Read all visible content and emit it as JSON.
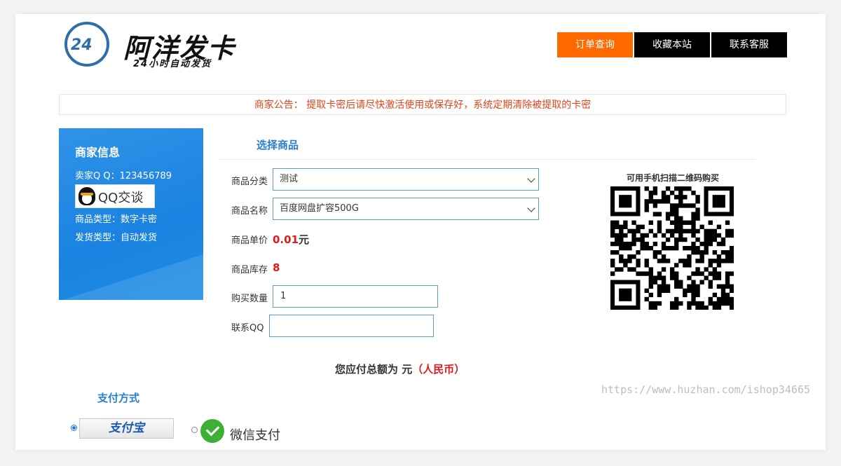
{
  "header": {
    "logo_number": "24",
    "brand_name": "阿洋发卡",
    "brand_tagline": "24小时自动发货",
    "nav": [
      {
        "label": "订单查询",
        "color": "#ff6a00"
      },
      {
        "label": "收藏本站",
        "color": "#000000"
      },
      {
        "label": "联系客服",
        "color": "#000000"
      }
    ]
  },
  "notice": {
    "text": "商家公告： 提取卡密后请尽快激活使用或保存好，系统定期清除被提取的卡密"
  },
  "merchant": {
    "title": "商家信息",
    "qq_line": "卖家Q Q：123456789",
    "qq_button": "QQ交谈",
    "type_line": "商品类型：数字卡密",
    "delivery_line": "发货类型：自动发货"
  },
  "form": {
    "section_title": "选择商品",
    "category_label": "商品分类",
    "category_value": "测试",
    "name_label": "商品名称",
    "name_value": "百度网盘扩容500G",
    "price_label": "商品单价",
    "price_value": "0.01",
    "price_unit": "元",
    "stock_label": "商品库存",
    "stock_value": "8",
    "qty_label": "购买数量",
    "qty_value": "1",
    "contact_label": "联系QQ",
    "contact_value": ""
  },
  "total": {
    "prefix": "您应付总额为 元",
    "currency": "（人民币）"
  },
  "qr": {
    "title": "可用手机扫描二维码购买"
  },
  "payment": {
    "title": "支付方式",
    "alipay_label": "支付宝",
    "wechat_label": "微信支付",
    "selected": "alipay"
  },
  "watermark": "https://www.huzhan.com/ishop34665"
}
